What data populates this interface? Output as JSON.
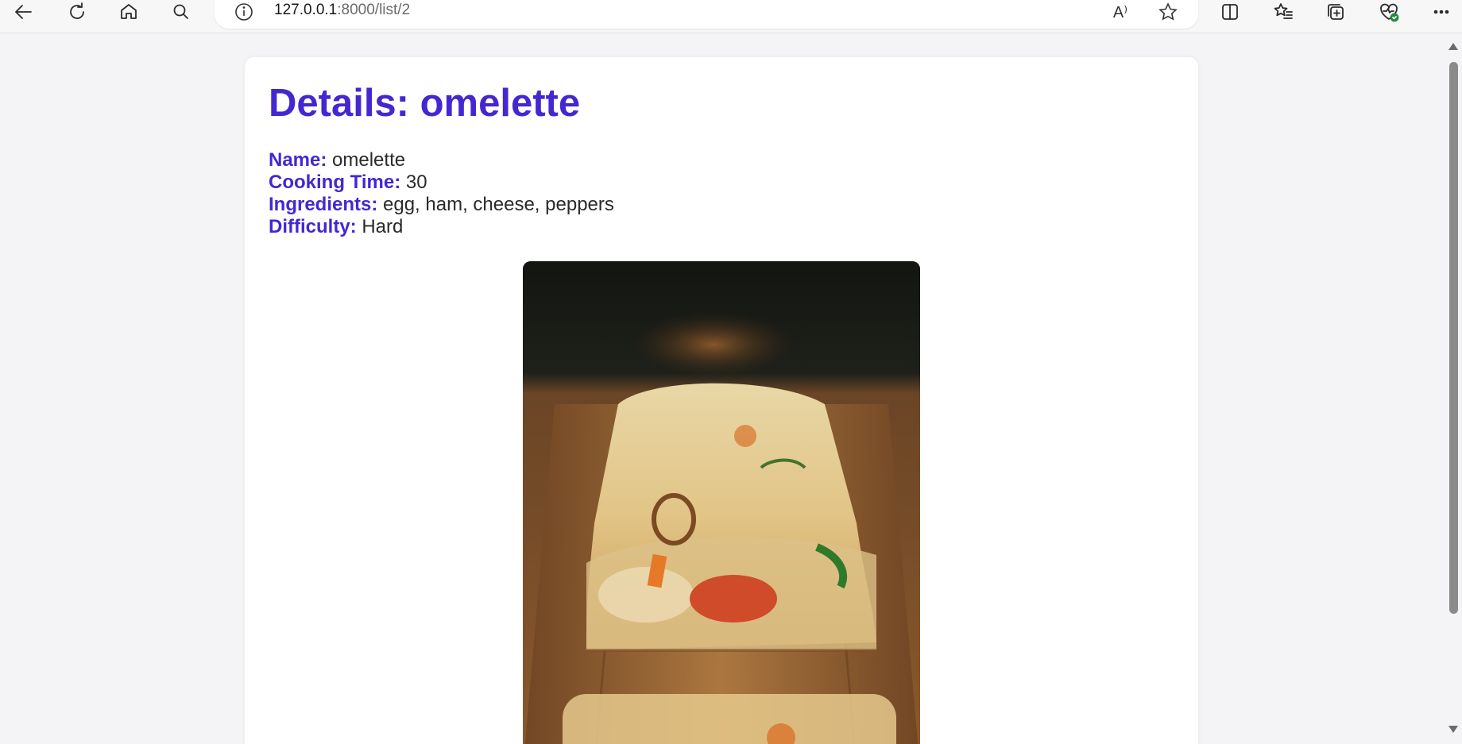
{
  "browser": {
    "url_host": "127.0.0.1",
    "url_path": ":8000/list/2",
    "read_aloud_glyph": "A⁾",
    "icons": [
      "back-icon",
      "refresh-icon",
      "home-icon",
      "search-icon",
      "info-icon",
      "read-aloud-icon",
      "favorite-star-icon",
      "split-screen-icon",
      "favorites-icon",
      "collections-icon",
      "browser-essentials-icon",
      "more-icon"
    ]
  },
  "page": {
    "title": "Details: omelette",
    "fields": {
      "name_label": "Name:",
      "name_value": "omelette",
      "cooking_time_label": "Cooking Time:",
      "cooking_time_value": "30",
      "ingredients_label": "Ingredients:",
      "ingredients_value": "egg, ham, cheese, peppers",
      "difficulty_label": "Difficulty:",
      "difficulty_value": "Hard"
    }
  },
  "colors": {
    "accent": "#4527d1",
    "page_bg": "#f4f4f6",
    "card_bg": "#ffffff"
  }
}
